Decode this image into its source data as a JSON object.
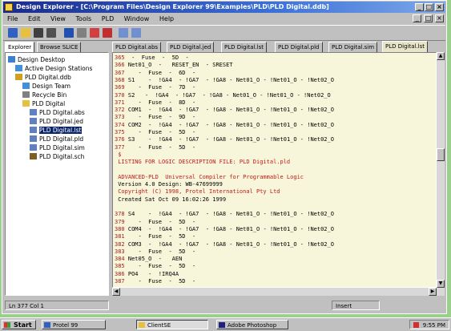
{
  "window": {
    "title": "Design Explorer - [C:\\Program Files\\Design Explorer 99\\Examples\\PLD\\PLD Digital.ddb]"
  },
  "menu": [
    "File",
    "Edit",
    "View",
    "Tools",
    "PLD",
    "Window",
    "Help"
  ],
  "left_tabs": [
    "Explorer",
    "Browse SLICE"
  ],
  "tree": [
    {
      "label": "Design Desktop",
      "indent": 0,
      "icon": "desktop-icon"
    },
    {
      "label": "Active Design Stations",
      "indent": 1,
      "icon": "station-icon"
    },
    {
      "label": "PLD Digital.ddb",
      "indent": 1,
      "icon": "database-icon"
    },
    {
      "label": "Design Team",
      "indent": 2,
      "icon": "team-icon"
    },
    {
      "label": "Recycle Bin",
      "indent": 2,
      "icon": "recycle-bin-icon"
    },
    {
      "label": "PLD Digital",
      "indent": 2,
      "icon": "folder-icon"
    },
    {
      "label": "PLD Digital.abs",
      "indent": 3,
      "icon": "document-icon"
    },
    {
      "label": "PLD Digital.jed",
      "indent": 3,
      "icon": "document-icon"
    },
    {
      "label": "PLD Digital.lst",
      "indent": 3,
      "icon": "document-icon",
      "selected": true
    },
    {
      "label": "PLD Digital.pld",
      "indent": 3,
      "icon": "document-icon"
    },
    {
      "label": "PLD Digital.sim",
      "indent": 3,
      "icon": "document-icon"
    },
    {
      "label": "PLD Digital.sch",
      "indent": 3,
      "icon": "schematic-icon"
    }
  ],
  "editor_tabs": [
    "PLD Digital.abs",
    "PLD Digital.jed",
    "PLD Digital.lst",
    "PLD Digital.pld",
    "PLD Digital.sim",
    "PLD Digital.lst"
  ],
  "active_tab": 5,
  "code_lines": [
    {
      "num": "365",
      "text": " -  Fuse  -  5D  -"
    },
    {
      "num": "366",
      "text": "Net01_O  -   RESET_EN  - SRESET"
    },
    {
      "num": "367",
      "text": "   -  Fuse  -  6D  -"
    },
    {
      "num": "368",
      "text": "S1    -  !GA4  - !GA7  - !GA8 - Net01_O - !Net01_O - !Net02_O"
    },
    {
      "num": "369",
      "text": "   -  Fuse  -  7D  -"
    },
    {
      "num": "370",
      "text": "S2   -  !GA4  - !GA7  - !GA8 - Net01_O - !Net01_O - !Net02_O"
    },
    {
      "num": "371",
      "text": "   -  Fuse  -  8D  -"
    },
    {
      "num": "372",
      "text": "COM1  -  !GA4  - !GA7  - !GA8 - Net01_O - !Net01_O - !Net02_O"
    },
    {
      "num": "373",
      "text": "   -  Fuse  -  9D  -"
    },
    {
      "num": "374",
      "text": "COM2  -  !GA4  - !GA7  - !GA8 - Net01_O - !Net01_O - !Net02_O"
    },
    {
      "num": "375",
      "text": "   -  Fuse  -  5D  -"
    },
    {
      "num": "376",
      "text": "S3    -  !GA4  - !GA7  - !GA8 - Net01_O - !Net01_O - !Net02_O"
    },
    {
      "num": "377",
      "text": "   -  Fuse  -  5D  -"
    },
    {
      "num": "",
      "text": "$",
      "red": true
    },
    {
      "num": "",
      "text": "LISTING FOR LOGIC DESCRIPTION FILE: PLD Digital.pld",
      "red": true
    },
    {
      "num": "",
      "text": "",
      "red": false
    },
    {
      "num": "",
      "text": "ADVANCED-PLD  Universal Compiler for Programmable Logic",
      "red": true
    },
    {
      "num": "",
      "text": "Version 4.0 Design: WB-47699999",
      "red": false
    },
    {
      "num": "",
      "text": "Copyright (C) 1998, Protel International Pty Ltd",
      "red": true
    },
    {
      "num": "",
      "text": "Created Sat Oct 09 16:02:26 1999",
      "red": false
    },
    {
      "num": "",
      "text": "",
      "red": false
    },
    {
      "num": "378",
      "text": "S4    -  !GA4  - !GA7  - !GA8 - Net01_O - !Net01_O - !Net02_O"
    },
    {
      "num": "379",
      "text": "   -  Fuse  -  5D  -"
    },
    {
      "num": "380",
      "text": "COM4  -  !GA4  - !GA7  - !GA8 - Net01_O - !Net01_O - !Net02_O"
    },
    {
      "num": "381",
      "text": "   -  Fuse  -  5D  -"
    },
    {
      "num": "382",
      "text": "COM3  -  !GA4  - !GA7  - !GA8 - Net01_O - !Net01_O - !Net02_O"
    },
    {
      "num": "383",
      "text": "   -  Fuse  -  5D  -"
    },
    {
      "num": "384",
      "text": "Net05_O  -   AEN"
    },
    {
      "num": "385",
      "text": "   -  Fuse  -  5D  -"
    },
    {
      "num": "386",
      "text": "PO4   -  !IRQ4A"
    },
    {
      "num": "387",
      "text": "   -  Fuse  -  5D  -"
    }
  ],
  "status": {
    "position": "Ln 377 Col 1",
    "mode": "Insert"
  },
  "taskbar": {
    "start": "Start",
    "tasks": [
      "Protel 99",
      "ClientSE",
      "Adobe Photoshop"
    ],
    "clock": "9:55 PM"
  }
}
